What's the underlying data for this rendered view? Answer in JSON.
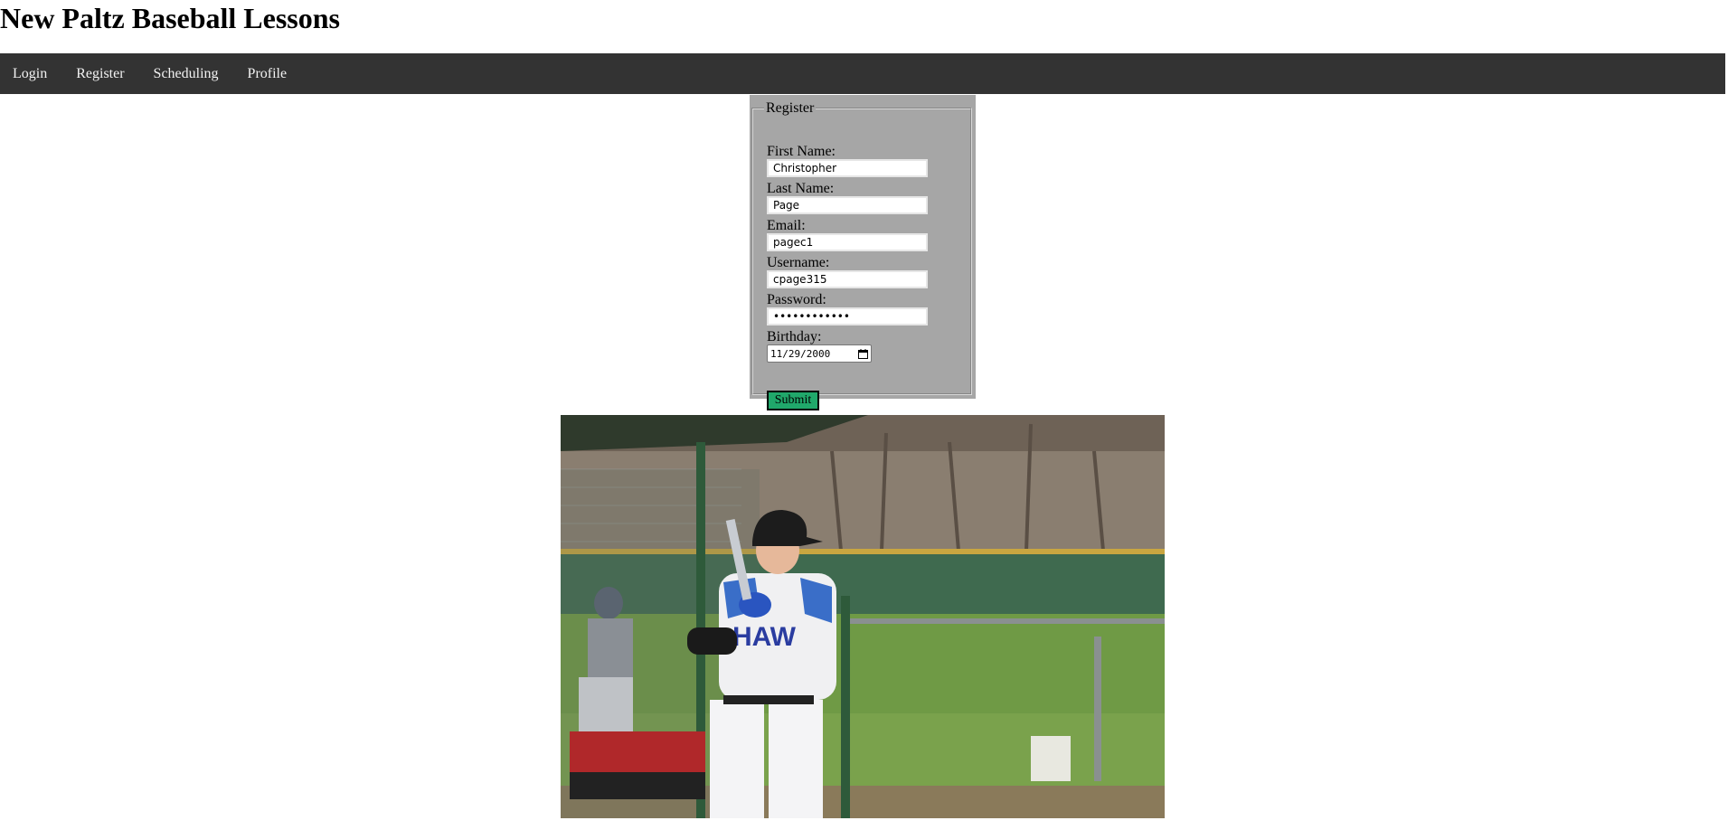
{
  "site": {
    "title": "New Paltz Baseball Lessons"
  },
  "nav": {
    "items": [
      {
        "label": "Login",
        "name": "nav-login"
      },
      {
        "label": "Register",
        "name": "nav-register"
      },
      {
        "label": "Scheduling",
        "name": "nav-scheduling"
      },
      {
        "label": "Profile",
        "name": "nav-profile"
      }
    ]
  },
  "form": {
    "legend": "Register",
    "first_name_label": "First Name:",
    "first_name_value": "Christopher",
    "last_name_label": "Last Name:",
    "last_name_value": "Page",
    "email_label": "Email:",
    "email_value": "pagec1",
    "username_label": "Username:",
    "username_value": "cpage315",
    "password_label": "Password:",
    "password_value": "••••••••••••",
    "birthday_label": "Birthday:",
    "birthday_value": "11/29/2000",
    "submit_label": "Submit",
    "submit_color": "#20a86b",
    "panel_color": "#a6a6a6"
  },
  "colors": {
    "navbar": "#333333",
    "nav_text": "#f2f2f2"
  },
  "icons": {
    "calendar": "calendar-icon"
  }
}
